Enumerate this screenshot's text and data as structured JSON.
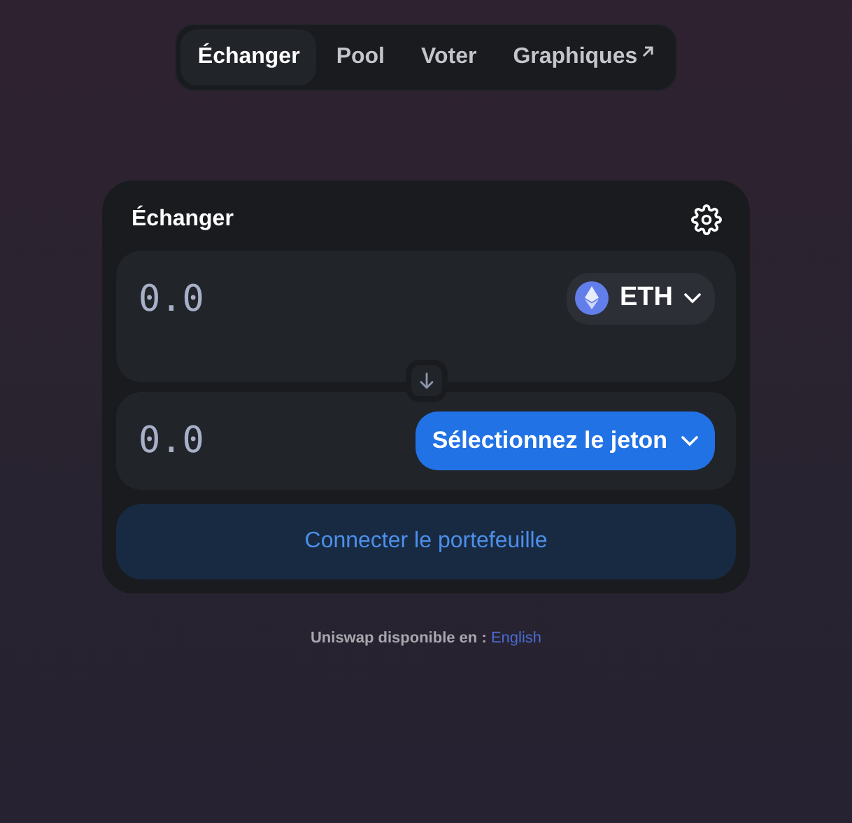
{
  "nav": {
    "tabs": [
      {
        "label": "Échanger",
        "selected": true,
        "external": false
      },
      {
        "label": "Pool",
        "selected": false,
        "external": false
      },
      {
        "label": "Voter",
        "selected": false,
        "external": false
      },
      {
        "label": "Graphiques",
        "selected": false,
        "external": true
      }
    ]
  },
  "swap": {
    "title": "Échanger",
    "inputs": [
      {
        "placeholder": "0.0",
        "token": {
          "kind": "token",
          "label": "ETH"
        }
      },
      {
        "placeholder": "0.0",
        "token": {
          "kind": "select",
          "label": "Sélectionnez le jeton"
        }
      }
    ],
    "connect_button": "Connecter le portefeuille"
  },
  "footer": {
    "text": "Uniswap disponible en :",
    "link": "English"
  }
}
